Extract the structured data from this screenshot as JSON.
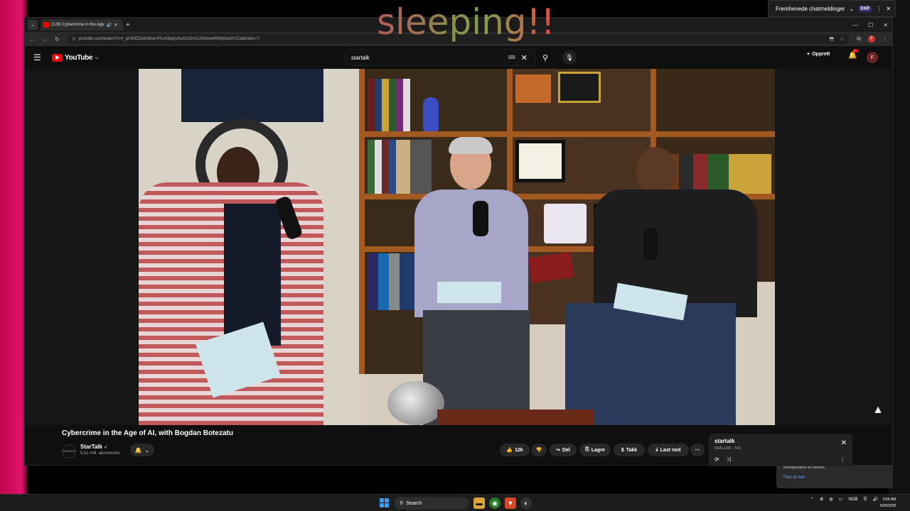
{
  "overlay": {
    "text": "sleeping!!"
  },
  "chat_panel": {
    "label": "Fremhevede chatmeldinger",
    "xp_badge": "0XP"
  },
  "browser": {
    "tab_title": "(128) Cybercrime in the Age",
    "url": "youtube.com/watch?v=f_qrXKEDrd0&list=PLml8qwySxXzxSmUJGbnw4594jmiotXVCa&index=7"
  },
  "youtube": {
    "logo_text": "YouTube",
    "logo_region": "NO",
    "search_value": "startalk",
    "create_label": "Opprett",
    "notif_badge": "9+",
    "avatar_letter": "F"
  },
  "video": {
    "title": "Cybercrime in the Age of AI, with Bogdan Botezatu",
    "channel": "StarTalk",
    "channel_avatar_text": "STARTALK",
    "subscribers": "5,51 mill. abonnenter",
    "likes": "12k",
    "share_label": "Del",
    "save_label": "Lagre",
    "thanks_label": "Takk",
    "download_label": "Last ned"
  },
  "mini_player": {
    "title": "startalk",
    "subtitle": "FRALLOR - 7/41"
  },
  "notification": {
    "text": "retningslinjene for brukere.",
    "link": "Finn ut mer"
  },
  "taskbar": {
    "search_label": "Search",
    "lang": "NOB",
    "time": "5:55 AM",
    "date": "5/26/2026"
  },
  "colors": {
    "accent_red": "#ff0000",
    "desktop_pink": "#e0136a",
    "link_blue": "#6fa8ff"
  }
}
